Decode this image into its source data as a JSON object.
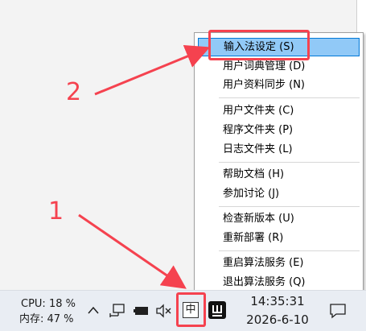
{
  "context_menu": {
    "items": [
      {
        "label": "输入法设定 (S)",
        "highlighted": true
      },
      {
        "label": "用户词典管理 (D)"
      },
      {
        "label": "用户资料同步 (N)"
      },
      {
        "label": "用户文件夹 (C)"
      },
      {
        "label": "程序文件夹 (P)"
      },
      {
        "label": "日志文件夹 (L)"
      },
      {
        "label": "帮助文档 (H)"
      },
      {
        "label": "参加讨论 (J)"
      },
      {
        "label": "检查新版本 (U)"
      },
      {
        "label": "重新部署 (R)"
      },
      {
        "label": "重启算法服务 (E)"
      },
      {
        "label": "退出算法服务 (Q)"
      }
    ]
  },
  "annotations": {
    "step1": "1",
    "step2": "2",
    "color": "#f5424f"
  },
  "taskbar": {
    "cpu": "CPU: 18 %",
    "mem": "内存: 47 %",
    "ime_glyph": "中",
    "time": "14:35:31",
    "date": "2026-6-10",
    "icons": [
      "chevron-up-icon",
      "network-icon",
      "battery-icon",
      "speaker-muted-icon",
      "ime-icon",
      "app-icon",
      "notification-icon"
    ]
  }
}
